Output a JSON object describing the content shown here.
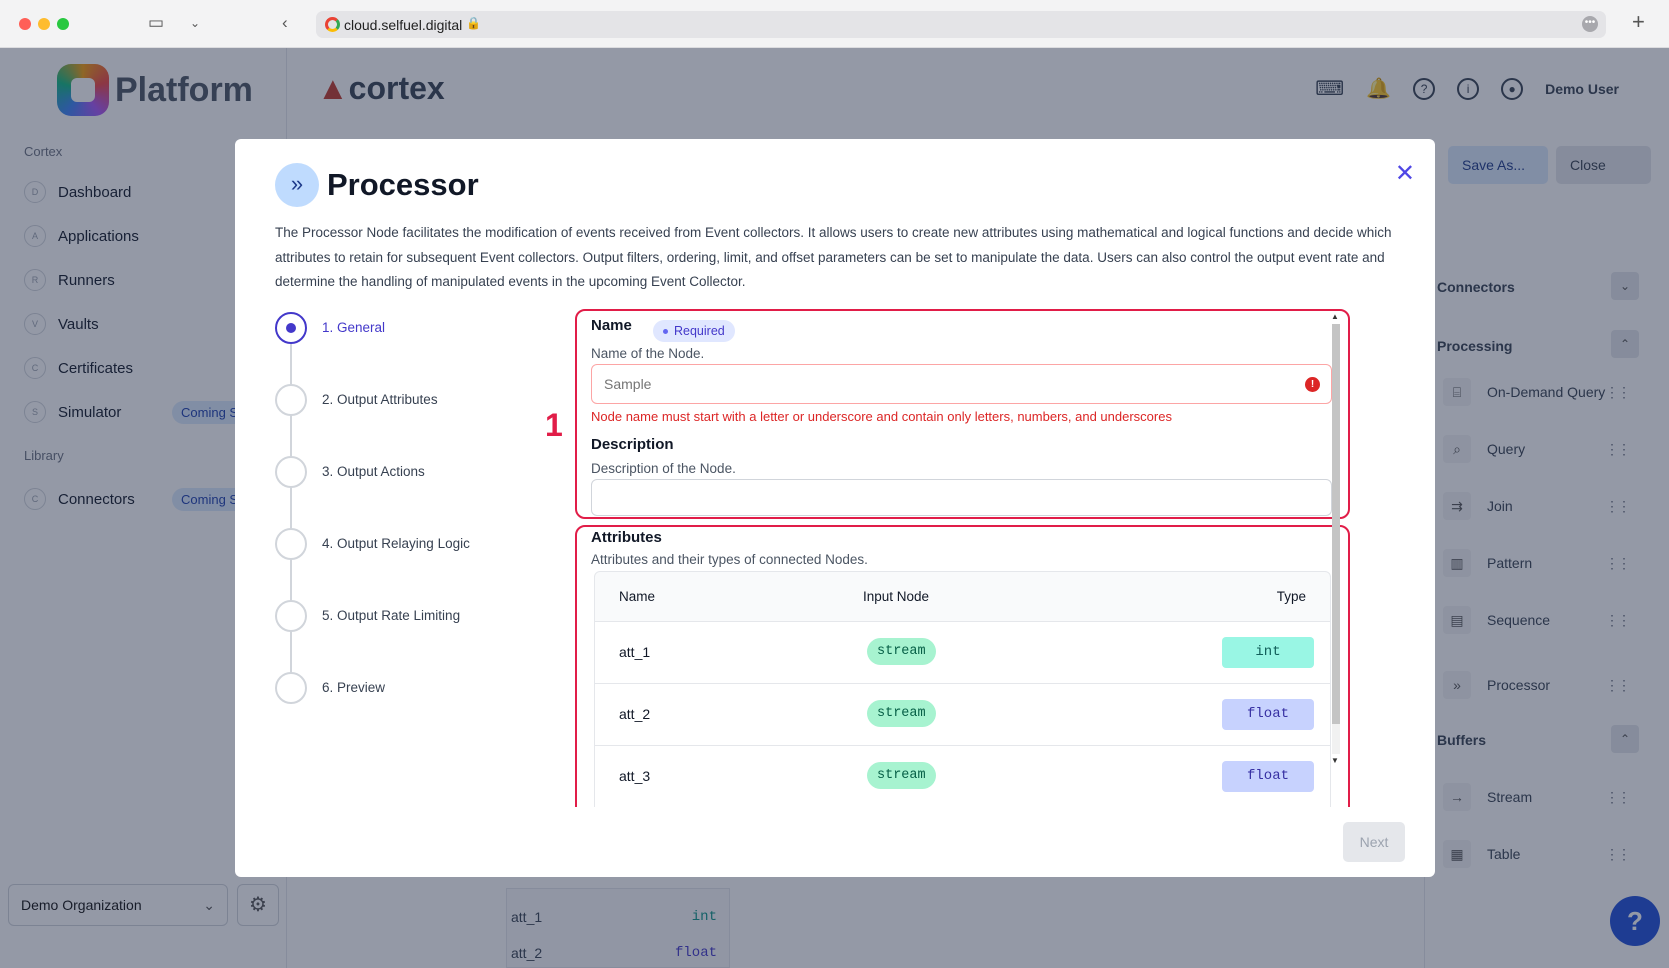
{
  "browser": {
    "url": "cloud.selfuel.digital"
  },
  "sidebar": {
    "brand": "Platform",
    "section_cortex": "Cortex",
    "section_library": "Library",
    "items": [
      {
        "badge": "D",
        "label": "Dashboard"
      },
      {
        "badge": "A",
        "label": "Applications"
      },
      {
        "badge": "R",
        "label": "Runners"
      },
      {
        "badge": "V",
        "label": "Vaults"
      },
      {
        "badge": "C",
        "label": "Certificates"
      },
      {
        "badge": "S",
        "label": "Simulator",
        "tag": "Coming Soon"
      }
    ],
    "library_items": [
      {
        "badge": "C",
        "label": "Connectors",
        "tag": "Coming Soon"
      }
    ],
    "organization": "Demo Organization"
  },
  "topbar": {
    "app_name": "cortex",
    "user": "Demo User",
    "save_as": "Save As...",
    "close": "Close"
  },
  "palette": {
    "sections": {
      "connectors": "Connectors",
      "processing": "Processing",
      "buffers": "Buffers"
    },
    "processing_items": [
      "On-Demand Query",
      "Query",
      "Join",
      "Pattern",
      "Sequence",
      "Processor"
    ],
    "buffer_items": [
      "Stream",
      "Table"
    ]
  },
  "canvas": {
    "rows": [
      {
        "name": "att_1",
        "type": "int"
      },
      {
        "name": "att_2",
        "type": "float"
      }
    ]
  },
  "modal": {
    "title": "Processor",
    "description": "The Processor Node facilitates the modification of events received from Event collectors. It allows users to create new attributes using mathematical and logical functions and decide which attributes to retain for subsequent Event collectors. Output filters, ordering, limit, and offset parameters can be set to manipulate the data. Users can also control the output event rate and determine the handling of manipulated events in the upcoming Event Collector.",
    "steps": [
      "1. General",
      "2. Output Attributes",
      "3. Output Actions",
      "4. Output Relaying Logic",
      "5. Output Rate Limiting",
      "6. Preview"
    ],
    "annotation_marker": "1",
    "name_field": {
      "label": "Name",
      "required_badge": "Required",
      "help": "Name of the Node.",
      "placeholder": "Sample",
      "error": "Node name must start with a letter or underscore and contain only letters, numbers, and underscores"
    },
    "description_field": {
      "label": "Description",
      "help": "Description of the Node.",
      "value": ""
    },
    "attributes": {
      "label": "Attributes",
      "help": "Attributes and their types of connected Nodes.",
      "columns": [
        "Name",
        "Input Node",
        "Type"
      ],
      "rows": [
        {
          "name": "att_1",
          "input_node": "stream",
          "type": "int"
        },
        {
          "name": "att_2",
          "input_node": "stream",
          "type": "float"
        },
        {
          "name": "att_3",
          "input_node": "stream",
          "type": "float"
        }
      ]
    },
    "next_button": "Next"
  }
}
